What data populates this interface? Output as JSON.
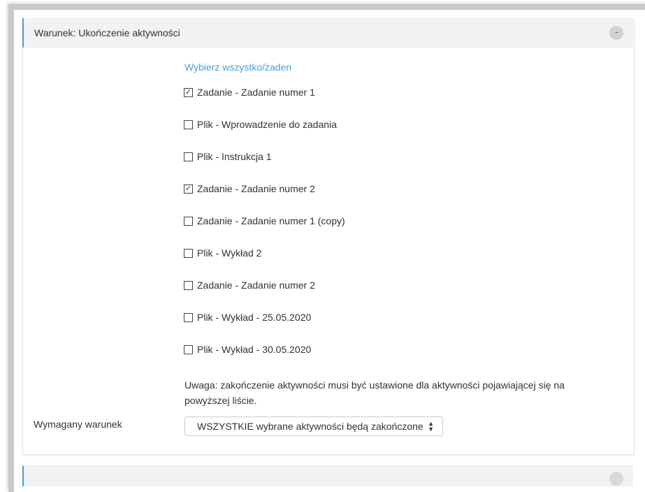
{
  "condition": {
    "title": "Warunek: Ukończenie aktywności",
    "toggle_label": "-",
    "select_all_label": "Wybierz wszystko/żaden",
    "items": [
      {
        "label": "Zadanie - Zadanie numer 1",
        "checked": true
      },
      {
        "label": "Plik - Wprowadzenie do zadania",
        "checked": false
      },
      {
        "label": "Plik - Instrukcja 1",
        "checked": false
      },
      {
        "label": "Zadanie - Zadanie numer 2",
        "checked": true
      },
      {
        "label": "Zadanie - Zadanie numer 1 (copy)",
        "checked": false
      },
      {
        "label": "Plik - Wykład 2",
        "checked": false
      },
      {
        "label": "Zadanie - Zadanie numer 2",
        "checked": false
      },
      {
        "label": "Plik - Wykład - 25.05.2020",
        "checked": false
      },
      {
        "label": "Plik - Wykład - 30.05.2020",
        "checked": false
      }
    ],
    "note_line1": "Uwaga: zakończenie aktywności musi być ustawione dla aktywności pojawiającej się na",
    "note_line2": "powyższej liście.",
    "required_label": "Wymagany warunek",
    "required_value": "WSZYSTKIE wybrane aktywności będą zakończone"
  },
  "colors": {
    "accent": "#4a9fd5",
    "header_bg": "#f2f2f2"
  },
  "icons": {
    "collapse": "minus-circle-icon",
    "select_arrows": "sort-arrows-icon",
    "checkbox_checked": "checkbox-checked-icon",
    "checkbox_unchecked": "checkbox-empty-icon"
  }
}
